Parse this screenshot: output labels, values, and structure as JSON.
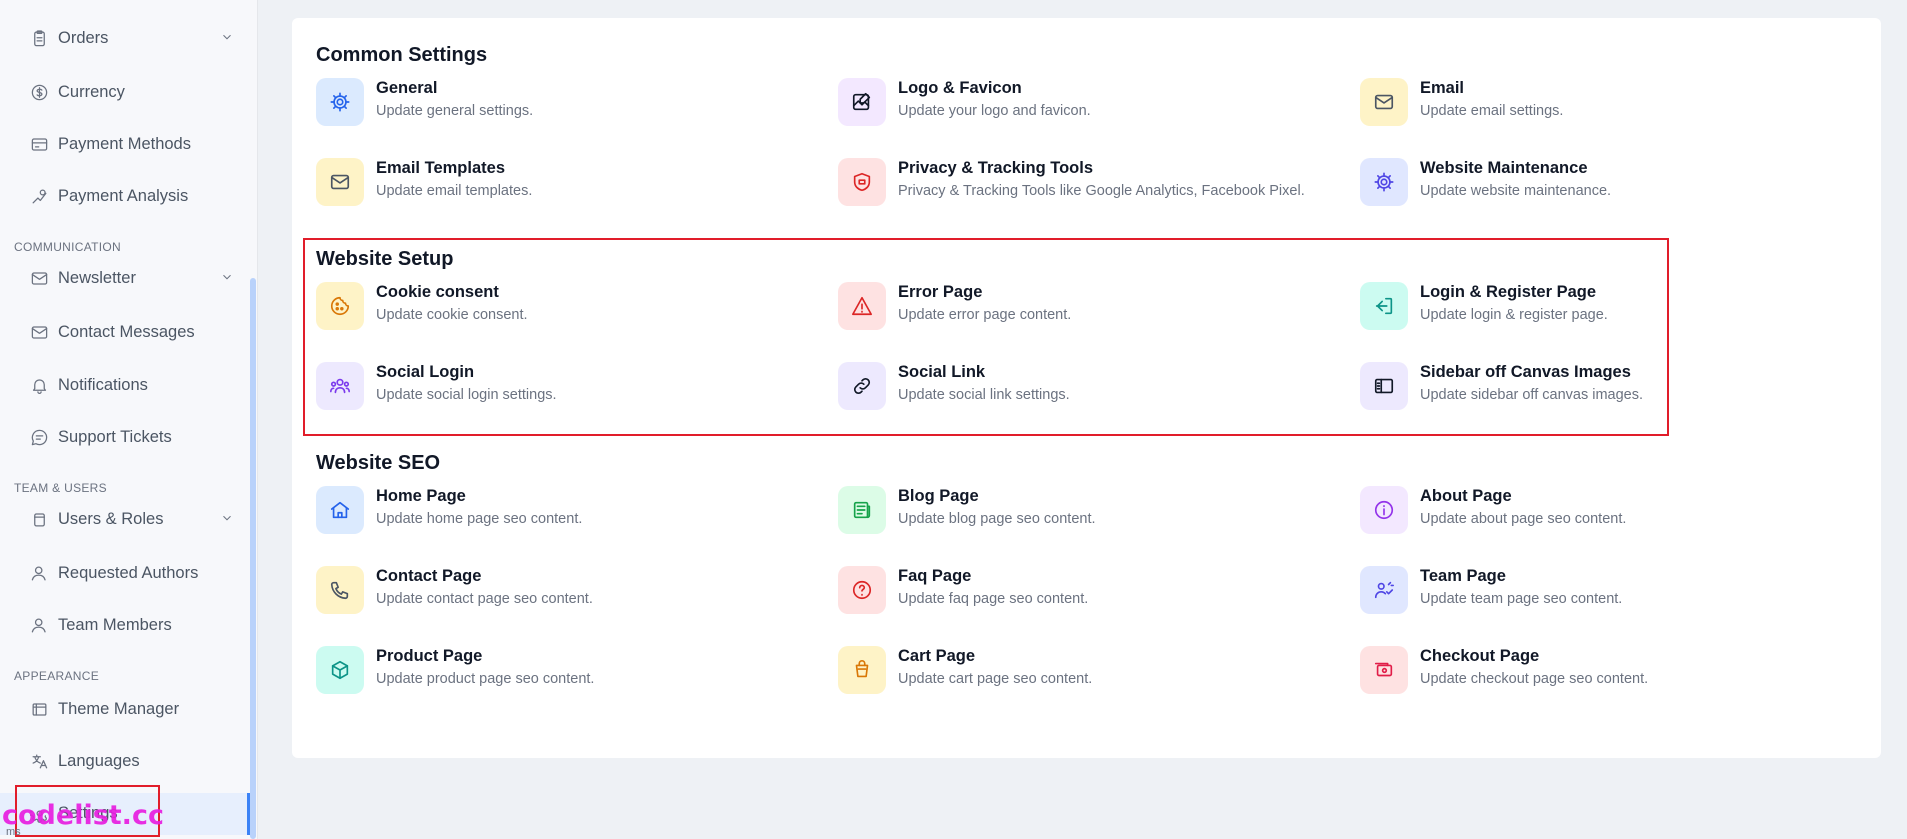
{
  "sidebar": {
    "items": [
      {
        "label": "Orders",
        "icon": "clipboard-icon",
        "chevron": true
      },
      {
        "label": "Currency",
        "icon": "currency-icon"
      },
      {
        "label": "Payment Methods",
        "icon": "credit-card-icon"
      },
      {
        "label": "Payment Analysis",
        "icon": "analysis-icon"
      },
      {
        "label": "Newsletter",
        "icon": "mail-icon",
        "chevron": true
      },
      {
        "label": "Contact Messages",
        "icon": "envelope-icon"
      },
      {
        "label": "Notifications",
        "icon": "bell-icon"
      },
      {
        "label": "Support Tickets",
        "icon": "chat-icon"
      },
      {
        "label": "Users & Roles",
        "icon": "users-roles-icon",
        "chevron": true
      },
      {
        "label": "Requested Authors",
        "icon": "user-icon"
      },
      {
        "label": "Team Members",
        "icon": "user-icon"
      },
      {
        "label": "Theme Manager",
        "icon": "theme-icon"
      },
      {
        "label": "Languages",
        "icon": "translate-icon"
      },
      {
        "label": "Settings",
        "icon": "gear-icon"
      }
    ],
    "sections": {
      "communication": "COMMUNICATION",
      "team": "TEAM & USERS",
      "appearance": "APPEARANCE"
    },
    "sub_tiny": "ms"
  },
  "watermark": "codelist.cc",
  "main": {
    "sections": [
      {
        "title": "Common Settings",
        "cards": [
          {
            "title": "General",
            "desc": "Update general settings.",
            "icon": "gear-icon",
            "bg": "#dbeafe",
            "fg": "#2563eb"
          },
          {
            "title": "Logo & Favicon",
            "desc": "Update your logo and favicon.",
            "icon": "image-edit-icon",
            "bg": "#f3e8ff",
            "fg": "#111827"
          },
          {
            "title": "Email",
            "desc": "Update email settings.",
            "icon": "mail-icon",
            "bg": "#fef3c7",
            "fg": "#4b5563"
          },
          {
            "title": "Email Templates",
            "desc": "Update email templates.",
            "icon": "mail-icon",
            "bg": "#fef3c7",
            "fg": "#4b5563"
          },
          {
            "title": "Privacy & Tracking Tools",
            "desc": "Privacy & Tracking Tools like Google Analytics, Facebook Pixel.",
            "icon": "shield-icon",
            "bg": "#fee2e2",
            "fg": "#dc2626"
          },
          {
            "title": "Website Maintenance",
            "desc": "Update website maintenance.",
            "icon": "gear-icon",
            "bg": "#e0e7ff",
            "fg": "#4f46e5"
          }
        ]
      },
      {
        "title": "Website Setup",
        "cards": [
          {
            "title": "Cookie consent",
            "desc": "Update cookie consent.",
            "icon": "cookie-icon",
            "bg": "#fef3c7",
            "fg": "#d97706"
          },
          {
            "title": "Error Page",
            "desc": "Update error page content.",
            "icon": "warning-icon",
            "bg": "#fee2e2",
            "fg": "#dc2626"
          },
          {
            "title": "Login & Register Page",
            "desc": "Update login & register page.",
            "icon": "login-icon",
            "bg": "#ccfbf1",
            "fg": "#0d9488"
          },
          {
            "title": "Social Login",
            "desc": "Update social login settings.",
            "icon": "group-icon",
            "bg": "#ede9fe",
            "fg": "#7c3aed"
          },
          {
            "title": "Social Link",
            "desc": "Update social link settings.",
            "icon": "link-icon",
            "bg": "#ede9fe",
            "fg": "#111827"
          },
          {
            "title": "Sidebar off Canvas Images",
            "desc": "Update sidebar off canvas images.",
            "icon": "sidebar-icon",
            "bg": "#ede9fe",
            "fg": "#111827"
          }
        ]
      },
      {
        "title": "Website SEO",
        "cards": [
          {
            "title": "Home Page",
            "desc": "Update home page seo content.",
            "icon": "home-icon",
            "bg": "#dbeafe",
            "fg": "#2563eb"
          },
          {
            "title": "Blog Page",
            "desc": "Update blog page seo content.",
            "icon": "newspaper-icon",
            "bg": "#dcfce7",
            "fg": "#16a34a"
          },
          {
            "title": "About Page",
            "desc": "Update about page seo content.",
            "icon": "info-icon",
            "bg": "#f3e8ff",
            "fg": "#9333ea"
          },
          {
            "title": "Contact Page",
            "desc": "Update contact page seo content.",
            "icon": "phone-icon",
            "bg": "#fef3c7",
            "fg": "#4b5563"
          },
          {
            "title": "Faq Page",
            "desc": "Update faq page seo content.",
            "icon": "question-icon",
            "bg": "#fee2e2",
            "fg": "#dc2626"
          },
          {
            "title": "Team Page",
            "desc": "Update team page seo content.",
            "icon": "team-icon",
            "bg": "#e0e7ff",
            "fg": "#4f46e5"
          },
          {
            "title": "Product Page",
            "desc": "Update product page seo content.",
            "icon": "box-icon",
            "bg": "#ccfbf1",
            "fg": "#0d9488"
          },
          {
            "title": "Cart Page",
            "desc": "Update cart page seo content.",
            "icon": "cart-icon",
            "bg": "#fef3c7",
            "fg": "#d97706"
          },
          {
            "title": "Checkout Page",
            "desc": "Update checkout page seo content.",
            "icon": "checkout-icon",
            "bg": "#fee2e2",
            "fg": "#e11d48"
          }
        ]
      }
    ]
  }
}
